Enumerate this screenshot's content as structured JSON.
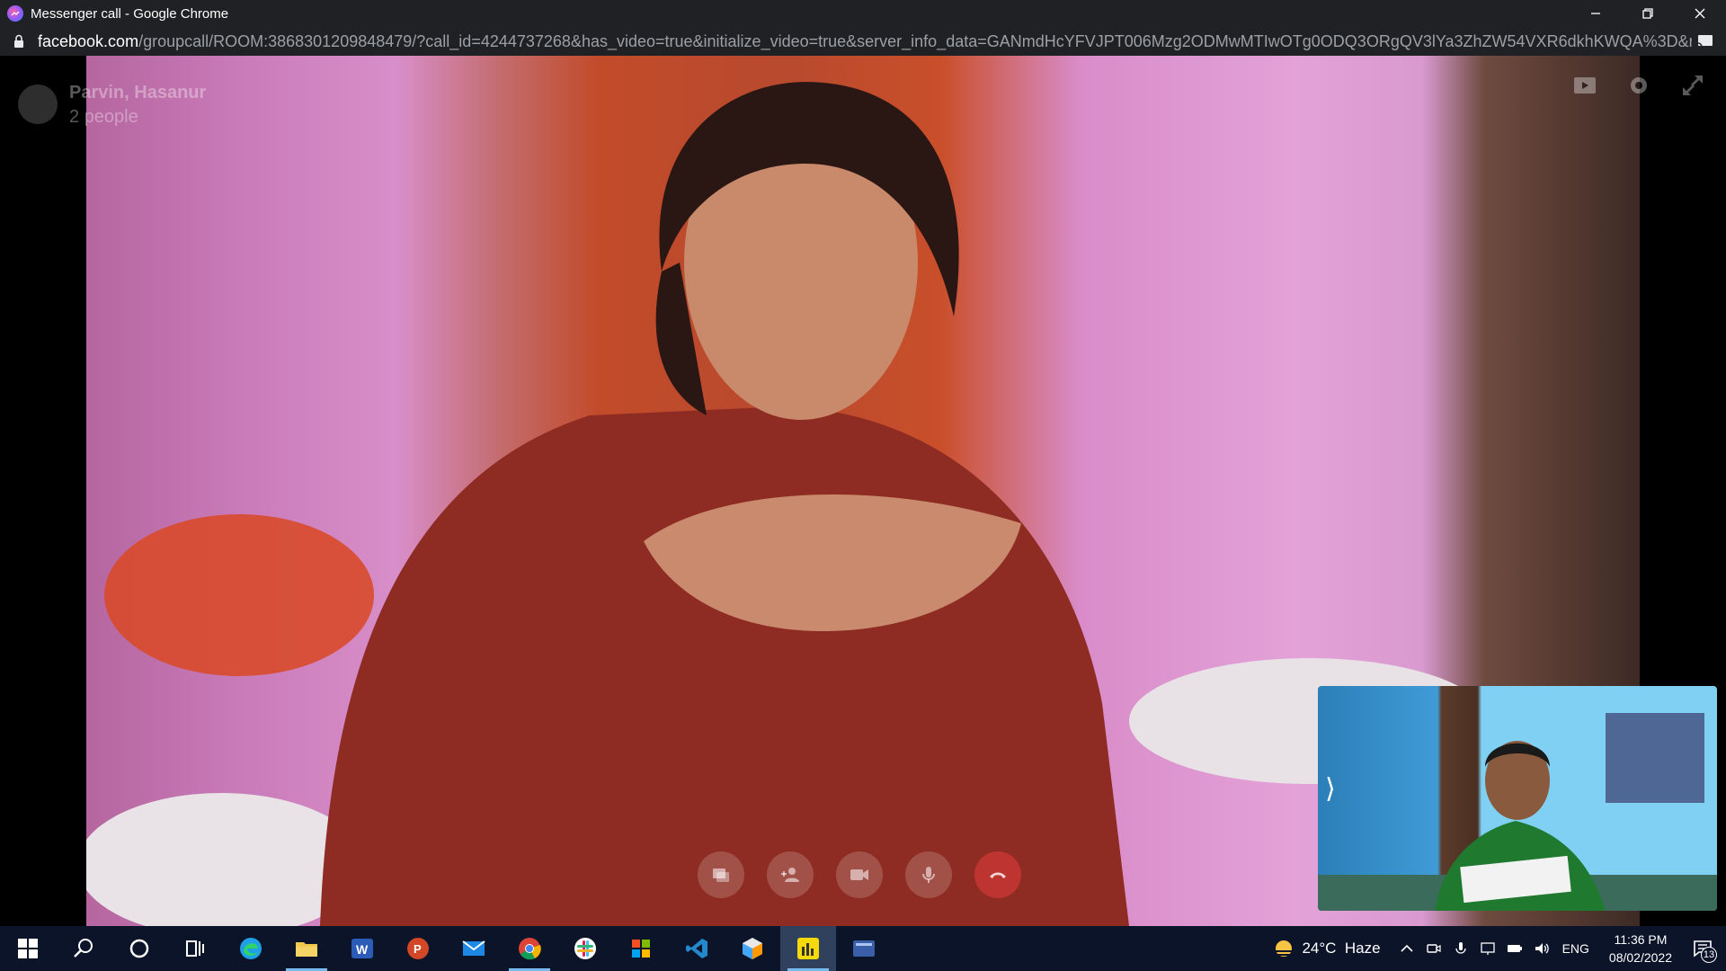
{
  "window": {
    "title": "Messenger call - Google Chrome",
    "url_host": "facebook.com",
    "url_path": "/groupcall/ROOM:3868301209848479/?call_id=4244737268&has_video=true&initialize_video=true&server_info_data=GANmdHcYFVJPT006Mzg2ODMwMTIwOTg0ODQ3ORgQV3lYa3ZhZW54VXR6dkhKWQA%3D&nonce=1..."
  },
  "call": {
    "name": "Parvin, Hasanur",
    "participants": "2 people",
    "controls": [
      "share-screen",
      "add-person",
      "video",
      "microphone",
      "end-call"
    ]
  },
  "taskbar": {
    "apps": [
      "start",
      "search",
      "cortana",
      "task-view",
      "edge",
      "file-explorer",
      "word",
      "powerpoint",
      "mail",
      "chrome",
      "slack",
      "store",
      "vs-code",
      "3d-viewer",
      "app-active",
      "app-window"
    ],
    "weather_temp": "24°C",
    "weather_desc": "Haze",
    "language": "ENG",
    "time": "11:36 PM",
    "date": "08/02/2022",
    "notification_count": "13"
  },
  "colors": {
    "chrome_bar": "#202124",
    "taskbar": "#0b1428",
    "end_call": "#e63c3c"
  }
}
